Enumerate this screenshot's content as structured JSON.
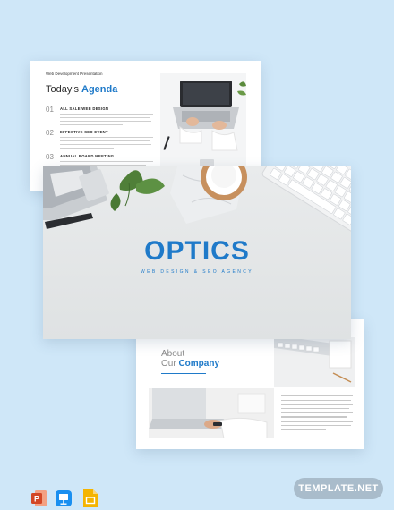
{
  "agenda_slide": {
    "header": "Web Development Presentation",
    "title_plain": "Today's ",
    "title_highlight": "Agenda",
    "items": [
      {
        "num": "01",
        "name": "ALL SALE WEB DESIGN"
      },
      {
        "num": "02",
        "name": "EFFECTIVE SEO EVENT"
      },
      {
        "num": "03",
        "name": "ANNUAL BOARD MEETING"
      }
    ]
  },
  "cover_slide": {
    "title": "OPTICS",
    "subtitle": "WEB DESIGN & SEO AGENCY"
  },
  "about_slide": {
    "title_line1": "About",
    "title_line2_plain": "Our ",
    "title_line2_highlight": "Company"
  },
  "apps": [
    {
      "icon": "powerpoint-icon",
      "color": "#d24726"
    },
    {
      "icon": "keynote-icon",
      "color": "#1a8ff0"
    },
    {
      "icon": "google-slides-icon",
      "color": "#f4b400"
    }
  ],
  "brand": {
    "label": "TEMPLATE.NET"
  },
  "colors": {
    "accent": "#1f7ac9",
    "background": "#cfe7f8"
  }
}
